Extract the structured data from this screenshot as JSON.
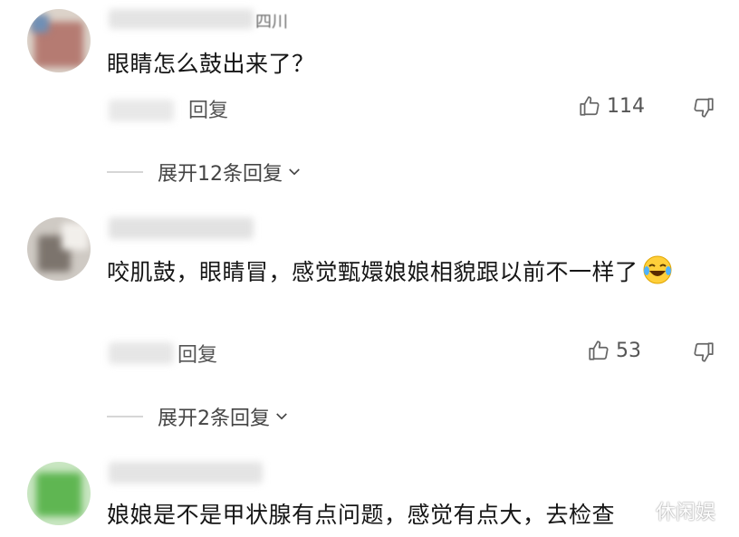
{
  "comments": [
    {
      "username_visible": "四川",
      "text": "眼睛怎么鼓出来了？",
      "reply_label": "回复",
      "likes": "114",
      "expand_label": "展开12条回复",
      "avatar_colors": [
        "#d9cfc6",
        "#a66b62",
        "#c98c84"
      ]
    },
    {
      "username_visible": "",
      "text": "咬肌鼓，眼睛冒，感觉甄嬛娘娘相貌跟以前不一样了",
      "reply_label": "回复",
      "likes": "53",
      "expand_label": "展开2条回复",
      "avatar_colors": [
        "#cbc6c0",
        "#8f8780",
        "#ece9e5"
      ]
    },
    {
      "username_visible": "",
      "text": "娘娘是不是甲状腺有点问题，感觉有点大，去检查",
      "avatar_colors": [
        "#bfe0b8",
        "#6cbf5f",
        "#3f9c34"
      ]
    }
  ],
  "watermark": "休闲娱",
  "colors": {
    "text": "#161616",
    "meta": "#555555",
    "divider": "#d6d6d6"
  },
  "icons": [
    "thumbs-up-icon",
    "thumbs-down-icon",
    "chevron-down-icon",
    "laughing-tears-emoji"
  ]
}
